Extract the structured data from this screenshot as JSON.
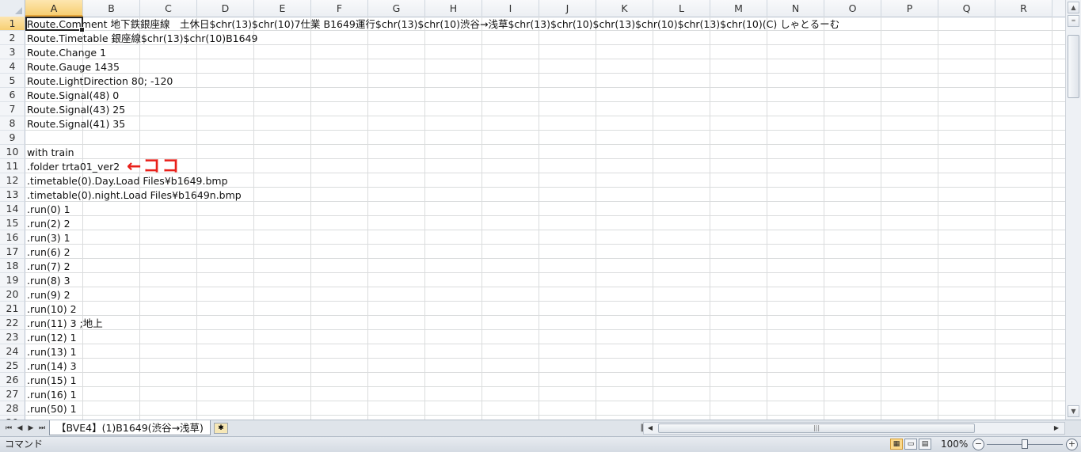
{
  "columns": [
    "A",
    "B",
    "C",
    "D",
    "E",
    "F",
    "G",
    "H",
    "I",
    "J",
    "K",
    "L",
    "M",
    "N",
    "O",
    "P",
    "Q",
    "R"
  ],
  "active_cell": {
    "column": "A",
    "row": 1
  },
  "rows": [
    {
      "num": "1",
      "text": "Route.Comment 地下鉄銀座線　土休日$chr(13)$chr(10)7仕業 B1649運行$chr(13)$chr(10)渋谷→浅草$chr(13)$chr(10)$chr(13)$chr(10)$chr(13)$chr(10)(C) しゃとるーむ"
    },
    {
      "num": "2",
      "text": "Route.Timetable 銀座線$chr(13)$chr(10)B1649"
    },
    {
      "num": "3",
      "text": "Route.Change 1"
    },
    {
      "num": "4",
      "text": "Route.Gauge 1435"
    },
    {
      "num": "5",
      "text": "Route.LightDirection 80; -120"
    },
    {
      "num": "6",
      "text": "Route.Signal(48) 0"
    },
    {
      "num": "7",
      "text": "Route.Signal(43) 25"
    },
    {
      "num": "8",
      "text": "Route.Signal(41) 35"
    },
    {
      "num": "9",
      "text": ""
    },
    {
      "num": "10",
      "text": "with train"
    },
    {
      "num": "11",
      "text": ".folder trta01_ver2"
    },
    {
      "num": "12",
      "text": ".timetable(0).Day.Load Files¥b1649.bmp"
    },
    {
      "num": "13",
      "text": ".timetable(0).night.Load Files¥b1649n.bmp"
    },
    {
      "num": "14",
      "text": ".run(0) 1"
    },
    {
      "num": "15",
      "text": ".run(2) 2"
    },
    {
      "num": "16",
      "text": ".run(3) 1"
    },
    {
      "num": "17",
      "text": ".run(6) 2"
    },
    {
      "num": "18",
      "text": ".run(7) 2"
    },
    {
      "num": "19",
      "text": ".run(8) 3"
    },
    {
      "num": "20",
      "text": ".run(9) 2"
    },
    {
      "num": "21",
      "text": ".run(10) 2"
    },
    {
      "num": "22",
      "text": ".run(11) 3 ;地上"
    },
    {
      "num": "23",
      "text": ".run(12) 1"
    },
    {
      "num": "24",
      "text": ".run(13) 1"
    },
    {
      "num": "25",
      "text": ".run(14) 3"
    },
    {
      "num": "26",
      "text": ".run(15) 1"
    },
    {
      "num": "27",
      "text": ".run(16) 1"
    },
    {
      "num": "28",
      "text": ".run(50) 1"
    },
    {
      "num": "29",
      "text": ""
    }
  ],
  "annotation": {
    "text": "←ココ",
    "color": "#e8201a"
  },
  "sheet_tab": {
    "label": "【BVE4】(1)B1649(渋谷→浅草)"
  },
  "status": {
    "mode": "コマンド",
    "zoom": "100%"
  },
  "icons": {
    "first_sheet": "first-sheet-icon",
    "prev_sheet": "prev-sheet-icon",
    "next_sheet": "next-sheet-icon",
    "last_sheet": "last-sheet-icon",
    "new_sheet": "new-sheet-icon",
    "normal_view": "normal-view-icon",
    "page_layout": "page-layout-icon",
    "page_break": "page-break-preview-icon",
    "zoom_out": "zoom-out-icon",
    "zoom_in": "zoom-in-icon"
  },
  "colors": {
    "selected_header": "#f7cf73",
    "annotation": "#e8201a"
  }
}
